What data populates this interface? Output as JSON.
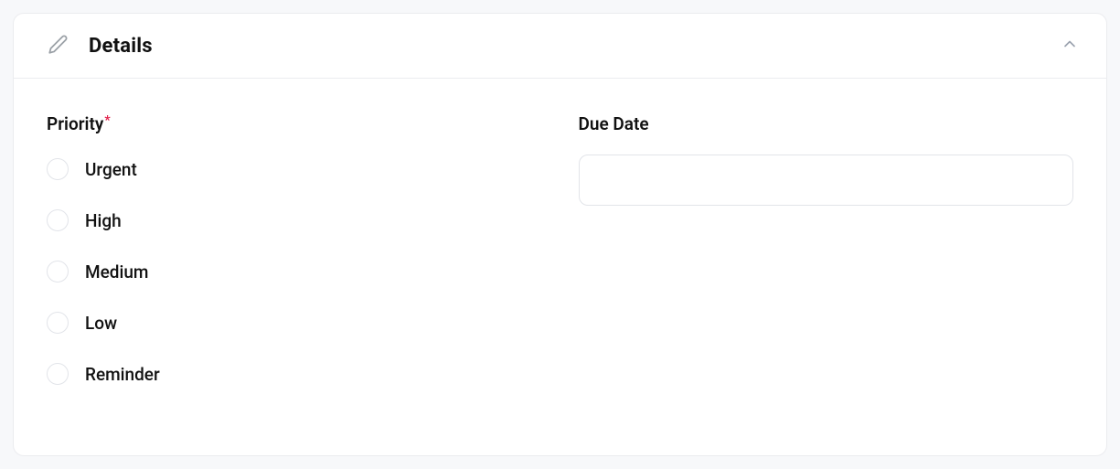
{
  "card": {
    "title": "Details"
  },
  "priority": {
    "label": "Priority",
    "options": [
      {
        "label": "Urgent"
      },
      {
        "label": "High"
      },
      {
        "label": "Medium"
      },
      {
        "label": "Low"
      },
      {
        "label": "Reminder"
      }
    ]
  },
  "dueDate": {
    "label": "Due Date",
    "value": ""
  }
}
